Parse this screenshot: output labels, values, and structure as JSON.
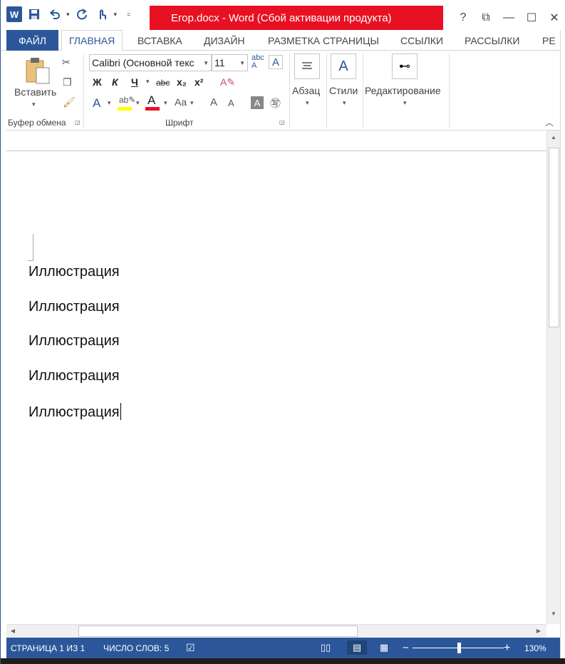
{
  "window": {
    "title": "Егор.docx - Word (Сбой активации продукта)",
    "controls": [
      "?",
      "⧉",
      "—",
      "☐",
      "✕"
    ]
  },
  "qat": {
    "icons": [
      "word-logo-icon",
      "save-icon",
      "undo-icon",
      "redo-icon",
      "touch-mode-icon",
      "customize-icon"
    ]
  },
  "tabs": {
    "file": "ФАЙЛ",
    "items": [
      "ГЛАВНАЯ",
      "ВСТАВКА",
      "ДИЗАЙН",
      "РАЗМЕТКА СТРАНИЦЫ",
      "ССЫЛКИ",
      "РАССЫЛКИ",
      "РЕ"
    ],
    "active": "ГЛАВНАЯ"
  },
  "ribbon": {
    "clipboard": {
      "paste_label": "Вставить",
      "group_label": "Буфер обмена"
    },
    "font": {
      "font_name": "Calibri (Основной текс",
      "font_size": "11",
      "bold": "Ж",
      "italic": "К",
      "underline": "Ч",
      "strike": "abc",
      "subscript": "x₂",
      "superscript": "x²",
      "grow": "A",
      "shrink": "A",
      "case": "Aa",
      "group_label": "Шрифт"
    },
    "paragraph": {
      "label": "Абзац"
    },
    "styles": {
      "label": "Стили"
    },
    "editing": {
      "label": "Редактирование"
    }
  },
  "document": {
    "paragraphs": [
      "Иллюстрация",
      "Иллюстрация",
      "Иллюстрация",
      "Иллюстрация",
      "Иллюстрация"
    ]
  },
  "status": {
    "page": "СТРАНИЦА 1 ИЗ 1",
    "words": "ЧИСЛО СЛОВ: 5",
    "zoom": "130%",
    "zoom_minus": "−",
    "zoom_plus": "+"
  },
  "colors": {
    "accent": "#2b579a",
    "title_alert": "#e81123",
    "highlight": "#ffff00",
    "font_color": "#e81123"
  }
}
